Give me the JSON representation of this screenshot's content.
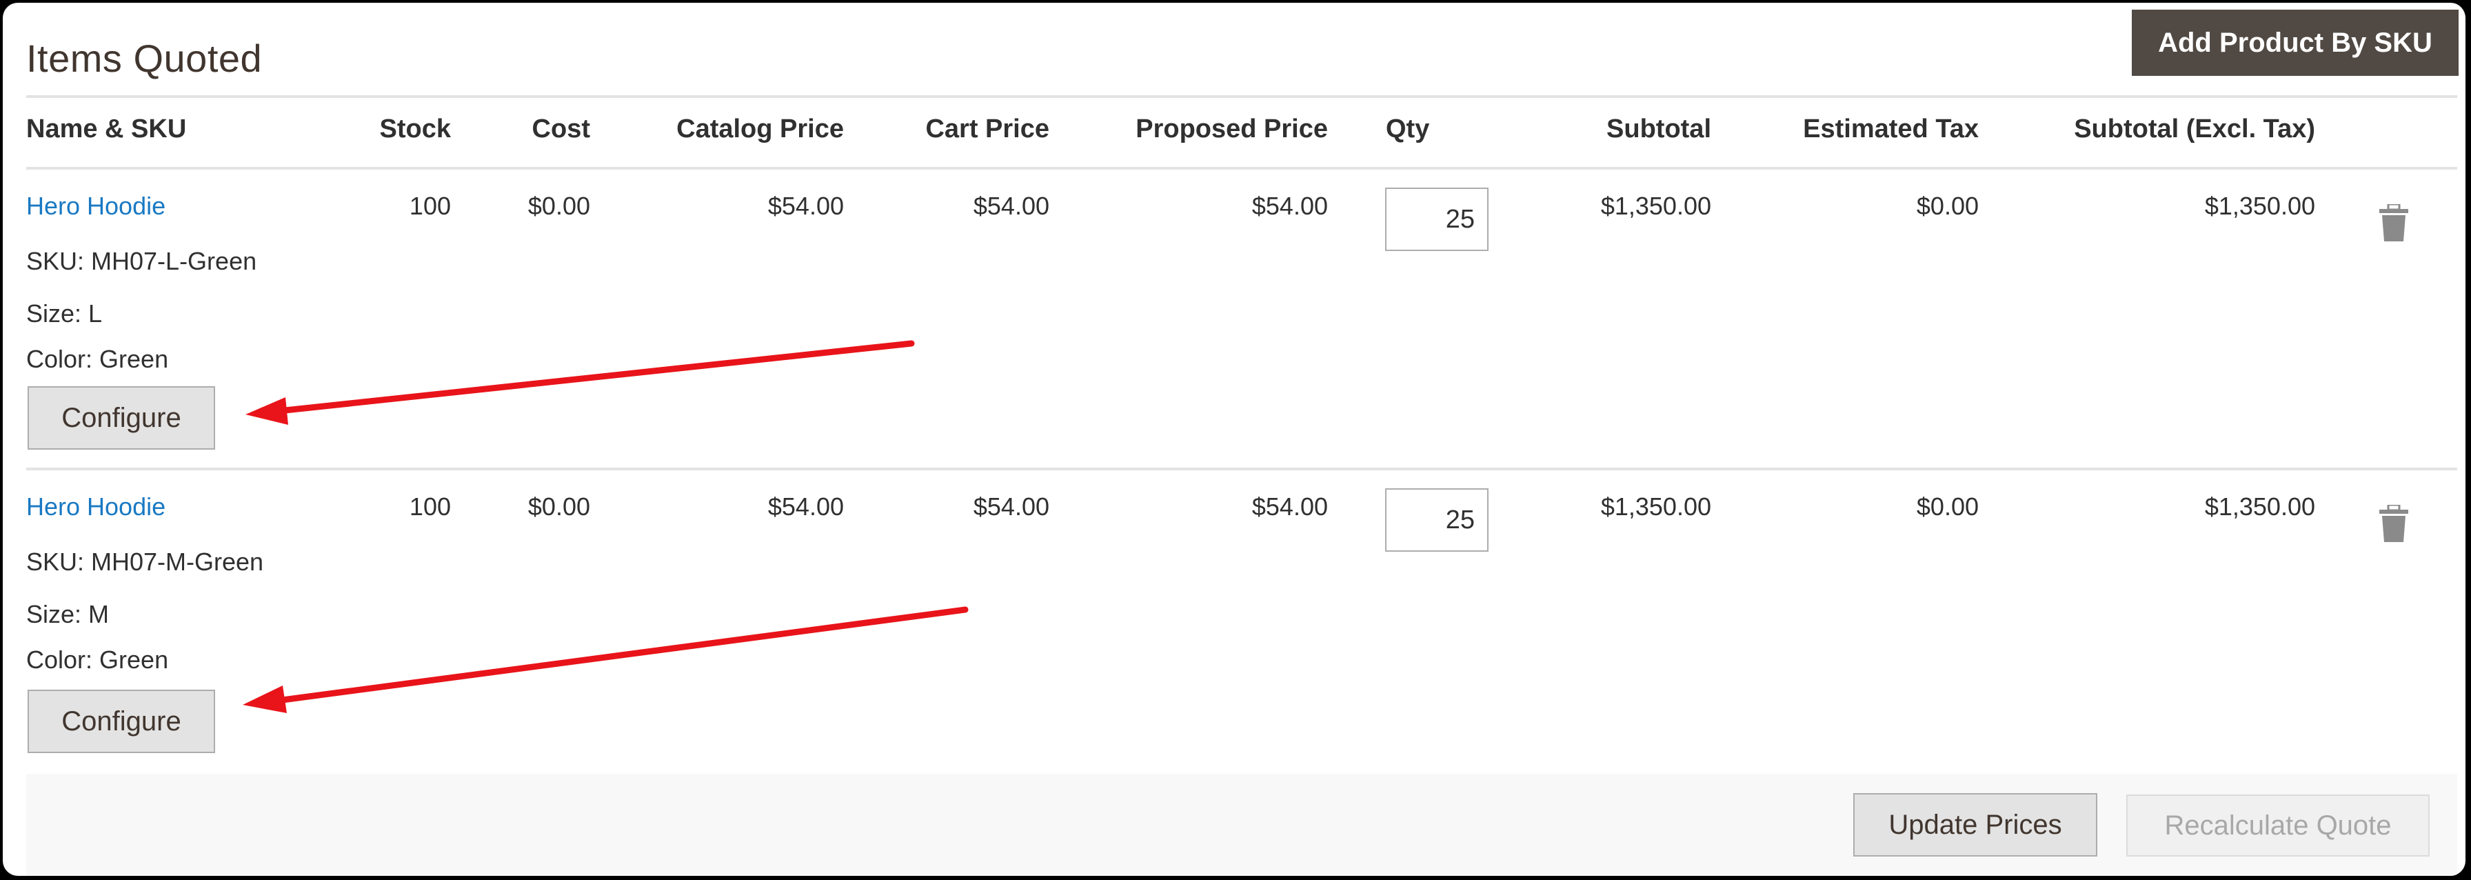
{
  "section": {
    "title": "Items Quoted",
    "add_product_by_sku_label": "Add Product By SKU"
  },
  "table": {
    "columns": [
      "Name & SKU",
      "Stock",
      "Cost",
      "Catalog Price",
      "Cart Price",
      "Proposed Price",
      "Qty",
      "Subtotal",
      "Estimated Tax",
      "Subtotal (Excl. Tax)"
    ],
    "rows": [
      {
        "name": "Hero Hoodie",
        "sku": "SKU: MH07-L-Green",
        "size": "Size: L",
        "color": "Color: Green",
        "stock": "100",
        "cost": "$0.00",
        "catalog_price": "$54.00",
        "cart_price": "$54.00",
        "proposed_price": "$54.00",
        "qty": "25",
        "subtotal": "$1,350.00",
        "estimated_tax": "$0.00",
        "subtotal_excl_tax": "$1,350.00",
        "configure_label": "Configure",
        "delete_icon": "trash-icon"
      },
      {
        "name": "Hero Hoodie",
        "sku": "SKU: MH07-M-Green",
        "size": "Size: M",
        "color": "Color: Green",
        "stock": "100",
        "cost": "$0.00",
        "catalog_price": "$54.00",
        "cart_price": "$54.00",
        "proposed_price": "$54.00",
        "qty": "25",
        "subtotal": "$1,350.00",
        "estimated_tax": "$0.00",
        "subtotal_excl_tax": "$1,350.00",
        "configure_label": "Configure",
        "delete_icon": "trash-icon"
      }
    ]
  },
  "footer": {
    "update_prices_label": "Update Prices",
    "recalculate_quote_label": "Recalculate Quote"
  },
  "annotations": {
    "arrow_color": "#e8141a",
    "arrows": [
      {
        "points_to": "row-1-configure-button"
      },
      {
        "points_to": "row-2-configure-button"
      }
    ]
  },
  "colors": {
    "link": "#1979c3",
    "primary_button": "#514943",
    "text": "#303030"
  }
}
